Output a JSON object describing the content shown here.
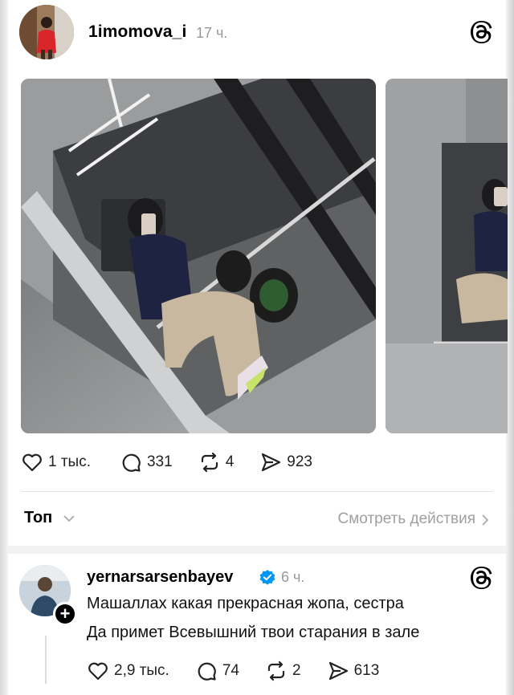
{
  "post": {
    "username": "1imomova_i",
    "time": "17 ч.",
    "stats": {
      "likes": "1 тыс.",
      "comments": "331",
      "reposts": "4",
      "shares": "923"
    }
  },
  "sort": {
    "label": "Топ",
    "view_activity": "Смотреть действия"
  },
  "reply": {
    "username": "yernarsarsenbayev",
    "time": "6 ч.",
    "line1": "Машаллах какая прекрасная жопа, сестра",
    "line2": "Да примет Всевышний твои старания в зале",
    "stats": {
      "likes": "2,9 тыс.",
      "comments": "74",
      "reposts": "2",
      "shares": "613"
    }
  },
  "icons": {
    "threads": "threads-logo-icon",
    "like": "heart-icon",
    "comment": "comment-bubble-icon",
    "repost": "repost-icon",
    "share": "send-icon",
    "verified": "verified-badge-icon",
    "chevron_down": "chevron-down-icon",
    "chevron_right": "chevron-right-icon"
  },
  "colors": {
    "accent_verified": "#0095f6",
    "muted_text": "#999999"
  }
}
